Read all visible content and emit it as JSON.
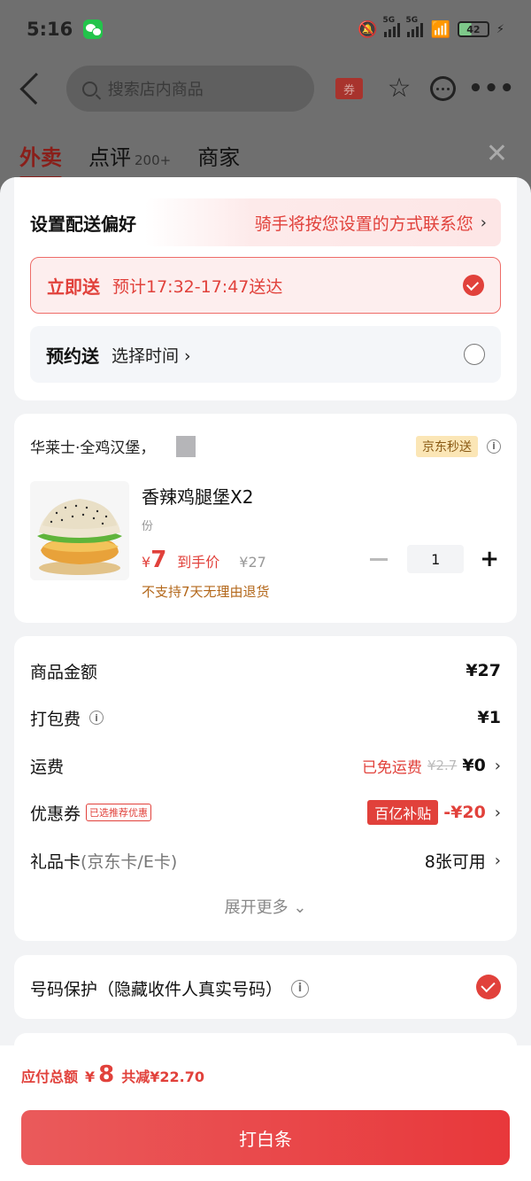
{
  "status": {
    "time": "5:16",
    "net1": "5G",
    "net2": "5G",
    "battery": "42"
  },
  "header": {
    "search_placeholder": "搜索店内商品",
    "coupon_label": "券"
  },
  "bg_tabs": [
    {
      "label": "外卖",
      "sub": ""
    },
    {
      "label": "点评",
      "sub": "200+"
    },
    {
      "label": "商家",
      "sub": ""
    }
  ],
  "delivery": {
    "title": "设置配送偏好",
    "hint": "骑手将按您设置的方式联系您",
    "now": {
      "name": "立即送",
      "desc": "预计17:32-17:47送达"
    },
    "later": {
      "name": "预约送",
      "desc": "选择时间"
    }
  },
  "product": {
    "store": "华莱士·全鸡汉堡，",
    "tag": "京东秒送",
    "title": "香辣鸡腿堡X2",
    "unit": "份",
    "price_symbol": "¥",
    "price": "7",
    "price_label": "到手价",
    "orig_price": "¥27",
    "quantity": "1",
    "notice": "不支持7天无理由退货"
  },
  "fees": {
    "goods": {
      "label": "商品金额",
      "value": "¥27"
    },
    "packing": {
      "label": "打包费",
      "value": "¥1"
    },
    "shipping": {
      "label": "运费",
      "free": "已免运费",
      "orig": "¥2.7",
      "value": "¥0"
    },
    "coupon": {
      "label": "优惠券",
      "tag": "已选推荐优惠",
      "badge": "百亿补贴",
      "value": "-¥20"
    },
    "giftcard": {
      "label": "礼品卡",
      "sub": "(京东卡/E卡)",
      "value": "8张可用"
    },
    "expand": "展开更多"
  },
  "protect": {
    "label": "号码保护（隐藏收件人真实号码）"
  },
  "footer": {
    "total_label": "应付总额",
    "total_symbol": "¥",
    "total": "8",
    "saved": "共减¥22.70",
    "pay_button": "打白条"
  },
  "colors": {
    "accent": "#e1413b",
    "tag_bg": "#fbe6b6"
  }
}
